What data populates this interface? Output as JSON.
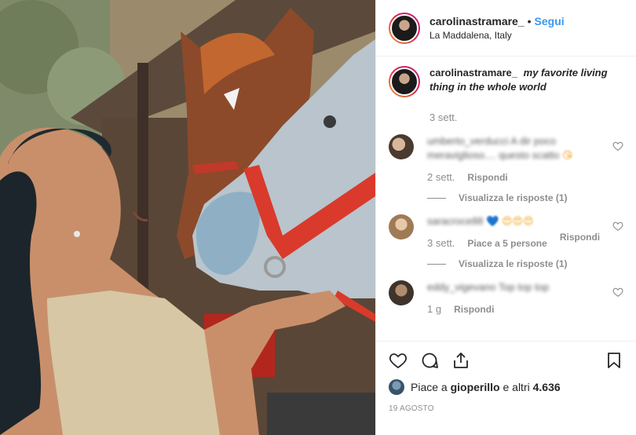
{
  "header": {
    "username": "carolinastramare_",
    "separator": "•",
    "follow_label": "Segui",
    "location": "La Maddalena, Italy"
  },
  "caption": {
    "username": "carolinastramare_",
    "text": "my favorite living thing in the whole world",
    "time": "3 sett."
  },
  "comments": [
    {
      "username": "umberto_verducci",
      "text": "A dir poco meraviglioso.... questo scatto",
      "emoji": "😘",
      "time": "2 sett.",
      "likes": "",
      "reply_label": "Rispondi",
      "view_replies": "Visualizza le risposte (1)"
    },
    {
      "username": "saracroce88",
      "text": "",
      "emoji": "💙 😍😍😍",
      "time": "3 sett.",
      "likes": "Piace a 5 persone",
      "reply_label": "Rispondi",
      "view_replies": "Visualizza le risposte (1)"
    },
    {
      "username": "eddy_vigevano",
      "text": "Top top top",
      "emoji": "",
      "time": "1 g",
      "likes": "",
      "reply_label": "Rispondi",
      "view_replies": ""
    }
  ],
  "likes": {
    "prefix": "Piace a ",
    "user": "gioperillo",
    "suffix": " e altri ",
    "count": "4.636"
  },
  "date": "19 agosto",
  "icons": {
    "like": "heart-icon",
    "comment": "comment-bubble-icon",
    "share": "share-icon",
    "save": "bookmark-icon"
  },
  "colors": {
    "follow": "#3897f0",
    "text": "#262626",
    "muted": "#8e8e8e",
    "border": "#efefef"
  }
}
